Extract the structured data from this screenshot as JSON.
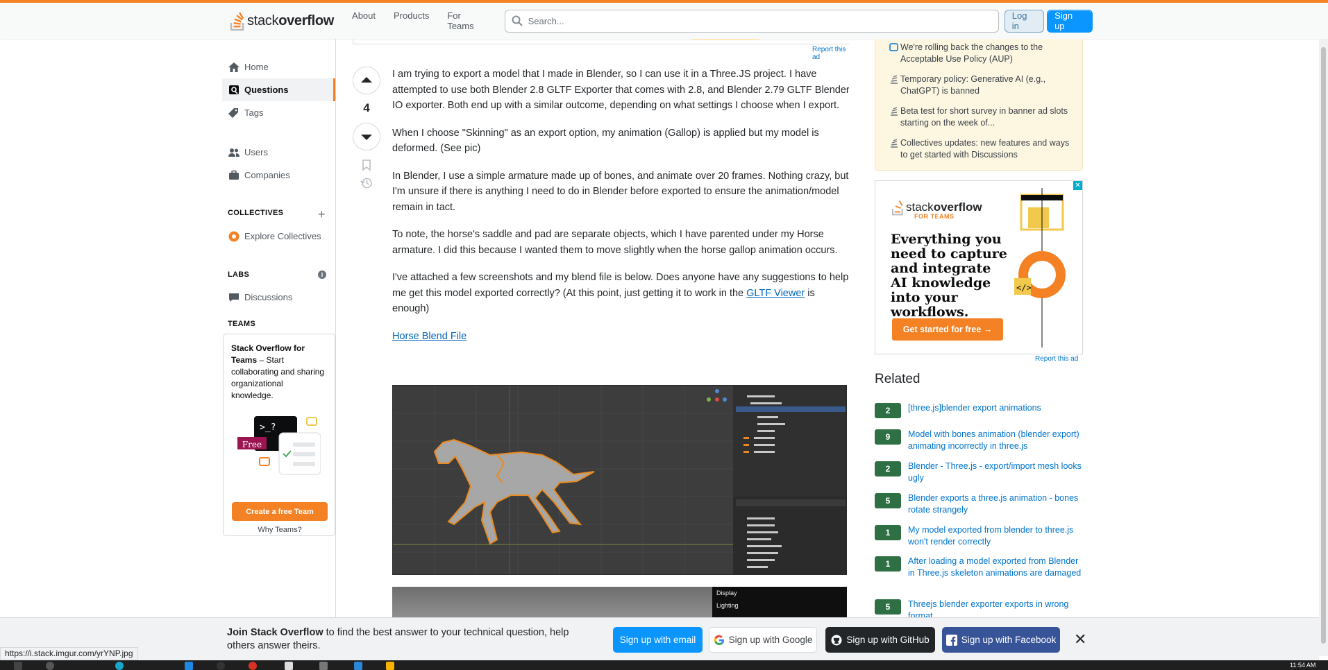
{
  "header": {
    "logo_stack": "stack",
    "logo_overflow": "overflow",
    "nav": [
      "About",
      "Products",
      "For Teams"
    ],
    "search_placeholder": "Search...",
    "login_label": "Log in",
    "signup_label": "Sign up"
  },
  "sidebar": {
    "home": "Home",
    "questions": "Questions",
    "tags": "Tags",
    "users": "Users",
    "companies": "Companies",
    "collectives_heading": "COLLECTIVES",
    "explore_collectives": "Explore Collectives",
    "labs_heading": "LABS",
    "discussions": "Discussions",
    "teams_heading": "TEAMS",
    "teams_title_bold": "Stack Overflow for Teams",
    "teams_title_rest": " – Start collaborating and sharing organizational knowledge.",
    "teams_free_badge": "Free",
    "teams_cta": "Create a free Team",
    "teams_why": "Why Teams?"
  },
  "question": {
    "vote_count": "4",
    "report_ad": "Report this ad",
    "paragraphs": [
      "I am trying to export a model that I made in Blender, so I can use it in a Three.JS project. I have attempted to use both Blender 2.8 GLTF Exporter that comes with 2.8, and Blender 2.79 GLTF Blender IO exporter. Both end up with a similar outcome, depending on what settings I choose when I export.",
      "When I choose \"Skinning\" as an export option, my animation (Gallop) is applied but my model is deformed. (See pic)",
      "In Blender, I use a simple armature made up of bones, and animate over 20 frames. Nothing crazy, but I'm unsure if there is anything I need to do in Blender before exported to ensure the animation/model remain in tact.",
      "To note, the horse's saddle and pad are separate objects, which I have parented under my Horse armature. I did this because I wanted them to move slightly when the horse gallop animation occurs."
    ],
    "para5_before": "I've attached a few screenshots and my blend file is below. Does anyone have any suggestions to help me get this model exported correctly? (At this point, just getting it to work in the ",
    "para5_link": "GLTF Viewer",
    "para5_after": " is enough)",
    "blend_link": "Horse Blend File",
    "screenshot2_menu": [
      "Display",
      "Lighting"
    ]
  },
  "right": {
    "blog_items": [
      "We're rolling back the changes to the Acceptable Use Policy (AUP)",
      "Temporary policy: Generative AI (e.g., ChatGPT) is banned",
      "Beta test for short survey in banner ad slots starting on the week of...",
      "Collectives updates: new features and ways to get started with Discussions"
    ],
    "ad_logo_stack": "stack",
    "ad_logo_overflow": "overflow",
    "ad_sub": "FOR TEAMS",
    "ad_copy": "Everything you need to capture and integrate AI knowledge into your workflows.",
    "ad_cta": "Get started for free →",
    "report_ad": "Report this ad",
    "related_title": "Related",
    "related": [
      {
        "votes": "2",
        "title": "[three.js]blender export animations"
      },
      {
        "votes": "9",
        "title": "Model with bones animation (blender export) animating incorrectly in three.js"
      },
      {
        "votes": "2",
        "title": "Blender - Three.js - export/import mesh looks ugly"
      },
      {
        "votes": "5",
        "title": "Blender exports a three.js animation - bones rotate strangely"
      },
      {
        "votes": "1",
        "title": "My model exported from blender to three.js won't render correctly"
      },
      {
        "votes": "1",
        "title": "After loading a model exported from Blender in Three.js skeleton animations are damaged"
      },
      {
        "votes": "5",
        "title": "Threejs blender exporter exports in wrong format"
      }
    ]
  },
  "banner": {
    "bold": "Join Stack Overflow",
    "text": " to find the best answer to your technical question, help others answer theirs.",
    "email": "Sign up with email",
    "google": "Sign up with Google",
    "github": "Sign up with GitHub",
    "facebook": "Sign up with Facebook",
    "close": "✕"
  },
  "status_url": "https://i.stack.imgur.com/yrYNP.jpg",
  "taskbar_time": "11:54 AM",
  "colors": {
    "brand": "#f48225",
    "accent": "#0a95ff",
    "related_badge": "#2f6f44"
  }
}
